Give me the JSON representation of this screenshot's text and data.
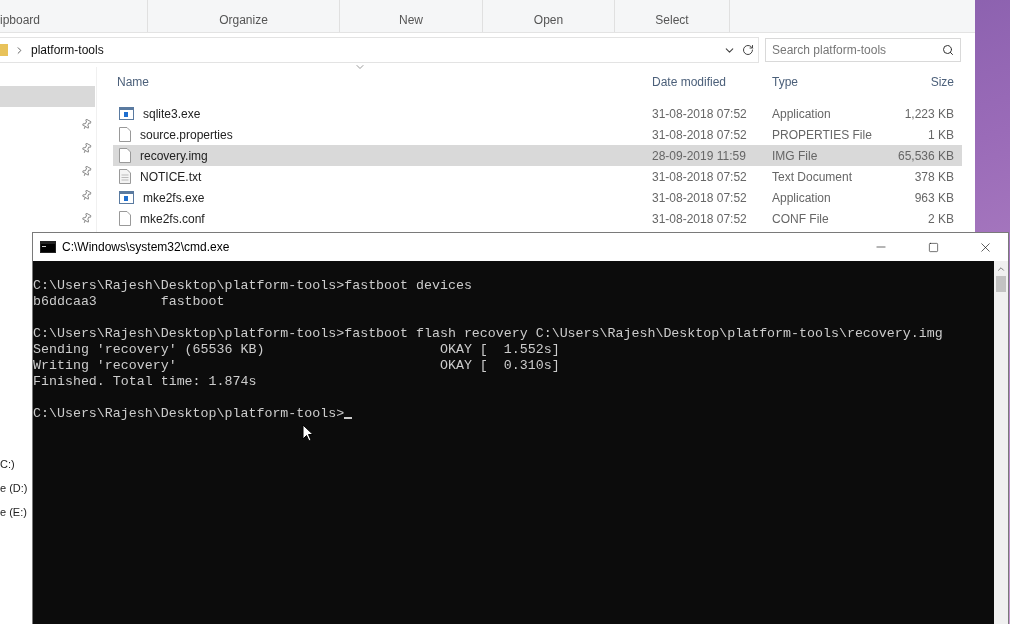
{
  "ribbon": {
    "groups": [
      "ipboard",
      "Organize",
      "New",
      "Open",
      "Select"
    ]
  },
  "address": {
    "path": "platform-tools",
    "search_placeholder": "Search platform-tools"
  },
  "navigation": {
    "drives": [
      {
        "label": "C:)"
      },
      {
        "label": "e (D:)"
      },
      {
        "label": "e (E:)"
      }
    ]
  },
  "files": {
    "columns": [
      "Name",
      "Date modified",
      "Type",
      "Size"
    ],
    "rows": [
      {
        "name": "sqlite3.exe",
        "modified": "31-08-2018 07:52",
        "type": "Application",
        "size": "1,223 KB",
        "kind": "exe",
        "selected": false
      },
      {
        "name": "source.properties",
        "modified": "31-08-2018 07:52",
        "type": "PROPERTIES File",
        "size": "1 KB",
        "kind": "file",
        "selected": false
      },
      {
        "name": "recovery.img",
        "modified": "28-09-2019 11:59",
        "type": "IMG File",
        "size": "65,536 KB",
        "kind": "file",
        "selected": true
      },
      {
        "name": "NOTICE.txt",
        "modified": "31-08-2018 07:52",
        "type": "Text Document",
        "size": "378 KB",
        "kind": "text",
        "selected": false
      },
      {
        "name": "mke2fs.exe",
        "modified": "31-08-2018 07:52",
        "type": "Application",
        "size": "963 KB",
        "kind": "exe",
        "selected": false
      },
      {
        "name": "mke2fs.conf",
        "modified": "31-08-2018 07:52",
        "type": "CONF File",
        "size": "2 KB",
        "kind": "file",
        "selected": false
      }
    ]
  },
  "console": {
    "title": "C:\\Windows\\system32\\cmd.exe",
    "cursor_visible": true,
    "blocks": [
      {
        "lines": [
          "C:\\Users\\Rajesh\\Desktop\\platform-tools>fastboot devices",
          "b6ddcaa3        fastboot"
        ]
      },
      {
        "lines": [
          "C:\\Users\\Rajesh\\Desktop\\platform-tools>fastboot flash recovery C:\\Users\\Rajesh\\Desktop\\platform-tools\\recovery.img",
          "Sending 'recovery' (65536 KB)                      OKAY [  1.552s]",
          "Writing 'recovery'                                 OKAY [  0.310s]",
          "Finished. Total time: 1.874s"
        ]
      },
      {
        "lines": [
          "C:\\Users\\Rajesh\\Desktop\\platform-tools>"
        ]
      }
    ]
  }
}
